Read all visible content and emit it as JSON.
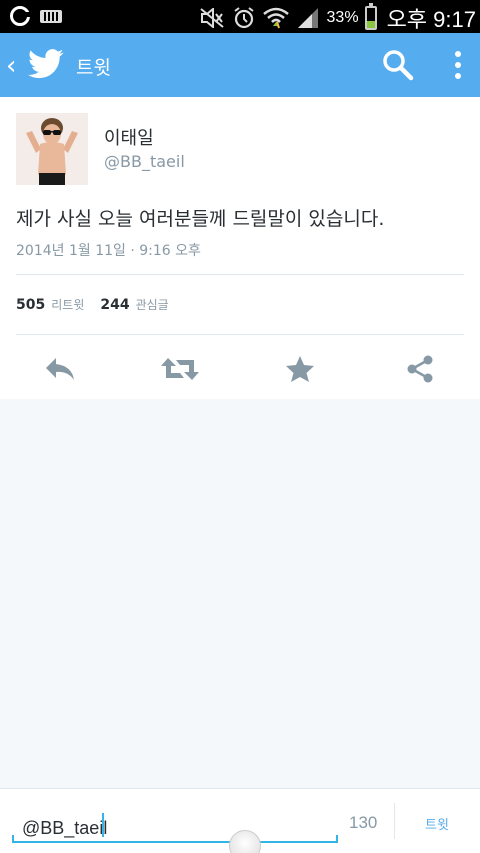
{
  "status_bar": {
    "battery_percent": "33%",
    "battery_level": 0.33,
    "ampm": "오후",
    "time": "9:17",
    "icons": [
      "carrier-logo-icon",
      "keyboard-icon",
      "mute-icon",
      "alarm-icon",
      "wifi-icon",
      "signal-icon",
      "battery-icon"
    ]
  },
  "app_bar": {
    "title": "트윗",
    "icons": [
      "back-icon",
      "twitter-bird-icon",
      "search-icon",
      "overflow-menu-icon"
    ],
    "accent": "#55acee"
  },
  "tweet": {
    "display_name": "이태일",
    "handle": "@BB_taeil",
    "text": "제가 사실 오늘 여러분들께 드릴말이 있습니다.",
    "timestamp": "2014년 1월 11일 · 9:16 오후",
    "retweet_count": "505",
    "retweet_label": "리트윗",
    "favorite_count": "244",
    "favorite_label": "관심글",
    "actions": [
      "reply-icon",
      "retweet-icon",
      "favorite-star-icon",
      "share-icon"
    ]
  },
  "composer": {
    "value": "@BB_taeil",
    "remaining_chars": "130",
    "send_label": "트윗"
  }
}
